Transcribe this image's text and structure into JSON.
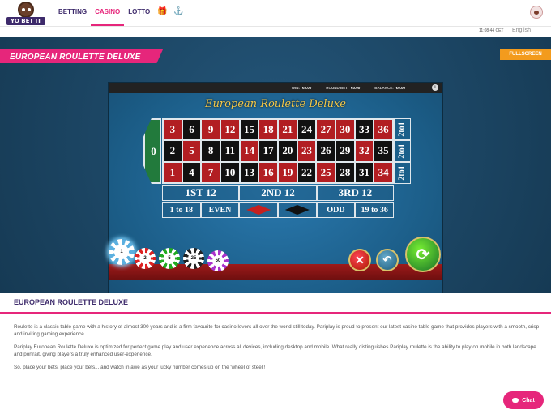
{
  "header": {
    "logo_text": "YO BET IT",
    "nav": [
      {
        "label": "BETTING",
        "active": false
      },
      {
        "label": "CASINO",
        "active": true
      },
      {
        "label": "LOTTO",
        "active": false
      }
    ],
    "icons": [
      "gift-icon",
      "bull-icon"
    ],
    "time": "11:08:44 CET",
    "language": "English"
  },
  "game": {
    "banner_title": "EUROPEAN ROULETTE DELUXE",
    "fullscreen_label": "FULLSCREEN",
    "stats": {
      "win_label": "WIN:",
      "win_value": "€0.00",
      "bet_label": "ROUND BET:",
      "bet_value": "€0.00",
      "balance_label": "BALANCE:",
      "balance_value": "€0.00"
    },
    "title": "European Roulette Deluxe",
    "zero": "0",
    "rows": [
      [
        3,
        6,
        9,
        12,
        15,
        18,
        21,
        24,
        27,
        30,
        33,
        36
      ],
      [
        2,
        5,
        8,
        11,
        14,
        17,
        20,
        23,
        26,
        29,
        32,
        35
      ],
      [
        1,
        4,
        7,
        10,
        13,
        16,
        19,
        22,
        25,
        28,
        31,
        34
      ]
    ],
    "red_numbers": [
      1,
      3,
      5,
      7,
      9,
      12,
      14,
      16,
      18,
      19,
      21,
      23,
      25,
      27,
      30,
      32,
      34,
      36
    ],
    "column_label": "2to1",
    "dozens": [
      "1ST 12",
      "2ND 12",
      "3RD 12"
    ],
    "outside": [
      "1 to 18",
      "EVEN",
      "",
      "",
      "ODD",
      "19 to 36"
    ],
    "chips": [
      "1",
      "2",
      "5",
      "25",
      "50"
    ],
    "buttons": {
      "clear": "✕",
      "undo": "↶",
      "spin": "⟳"
    }
  },
  "description": {
    "heading": "EUROPEAN ROULETTE DELUXE",
    "paragraphs": [
      "Roulette is a classic table game with a history of almost 300 years and is a firm favourite for casino lovers all over the world still today. Pariplay is proud to present our latest casino table game that provides players with a smooth, crisp and inviting gaming experience.",
      "Pariplay European Roulette Deluxe is optimized for perfect game play and user experience across all devices, including desktop and mobile. What really distinguishes Pariplay roulette is the ability to play on mobile in both landscape and portrait, giving players a truly enhanced user-experience.",
      "So, place your bets, place your bets... and watch in awe as your lucky number comes up on the 'wheel of steel'!"
    ]
  },
  "chat_label": "Chat",
  "colors": {
    "brand_pink": "#e6267b",
    "brand_purple": "#3d2a6b",
    "fullscreen_orange": "#f39b1d",
    "roulette_red": "#b21e22"
  }
}
